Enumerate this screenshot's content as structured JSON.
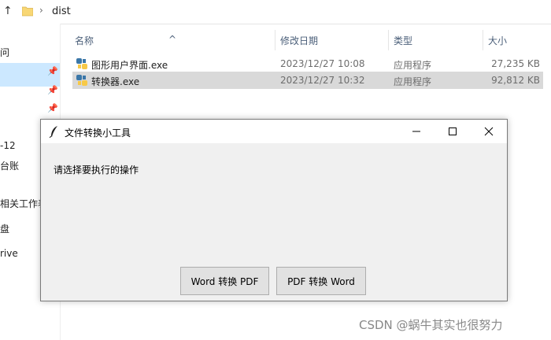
{
  "address_bar": {
    "path": "dist"
  },
  "nav": {
    "items": [
      {
        "label": "问"
      },
      {
        "label": "-12"
      },
      {
        "label": "台账"
      },
      {
        "label": "相关工作表"
      },
      {
        "label": "盘"
      },
      {
        "label": "rive"
      }
    ]
  },
  "columns": {
    "name": "名称",
    "modified": "修改日期",
    "type": "类型",
    "size": "大小"
  },
  "files": [
    {
      "name": "图形用户界面.exe",
      "modified": "2023/12/27 10:08",
      "type": "应用程序",
      "size": "27,235 KB",
      "selected": false
    },
    {
      "name": "转换器.exe",
      "modified": "2023/12/27 10:32",
      "type": "应用程序",
      "size": "92,812 KB",
      "selected": true
    }
  ],
  "window": {
    "title": "文件转换小工具",
    "prompt": "请选择要执行的操作",
    "buttons": {
      "word_to_pdf": "Word 转换 PDF",
      "pdf_to_word": "PDF 转换 Word"
    }
  },
  "watermark": "CSDN @蜗牛其实也很努力"
}
